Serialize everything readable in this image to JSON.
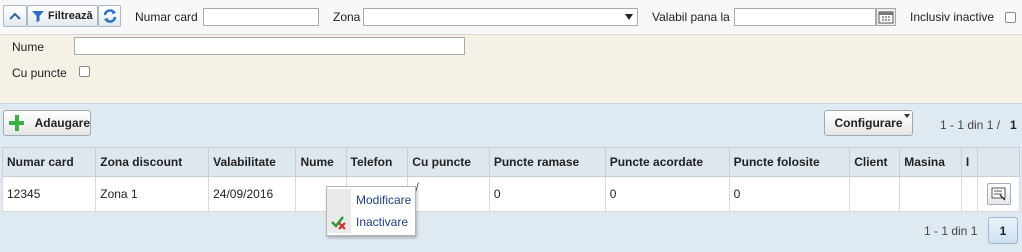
{
  "filter": {
    "button_label": "Filtrează",
    "card_label": "Numar card",
    "card_value": "",
    "zona_label": "Zona",
    "zona_value": "",
    "valabil_label": "Valabil pana la",
    "valabil_value": "",
    "inactive_label": "Inclusiv inactive",
    "nume_label": "Nume",
    "nume_value": "",
    "puncte_label": "Cu puncte"
  },
  "toolbar": {
    "add_label": "Adaugare",
    "config_label": "Configurare",
    "paging_text": "1 - 1 din 1 /",
    "paging_page": "1"
  },
  "table": {
    "columns": [
      "Numar card",
      "Zona discount",
      "Valabilitate",
      "Nume",
      "Telefon",
      "Cu puncte",
      "Puncte ramase",
      "Puncte acordate",
      "Puncte folosite",
      "Client",
      "Masina",
      "I"
    ],
    "rows": [
      {
        "numar_card": "12345",
        "zona": "Zona 1",
        "valabilitate": "24/09/2016",
        "nume": "",
        "telefon": "",
        "cu_puncte": "√",
        "ramase": "0",
        "acordate": "0",
        "folosite": "0",
        "client": "",
        "masina": ""
      }
    ]
  },
  "context_menu": {
    "edit_label": "Modificare",
    "deactivate_label": "Inactivare"
  },
  "footer": {
    "paging_text": "1 - 1 din 1",
    "page_button": "1"
  },
  "colors": {
    "accent_blue": "#1b3f8b",
    "header_bg": "#dfe7ee",
    "filter_bg": "#f6f1e6"
  }
}
